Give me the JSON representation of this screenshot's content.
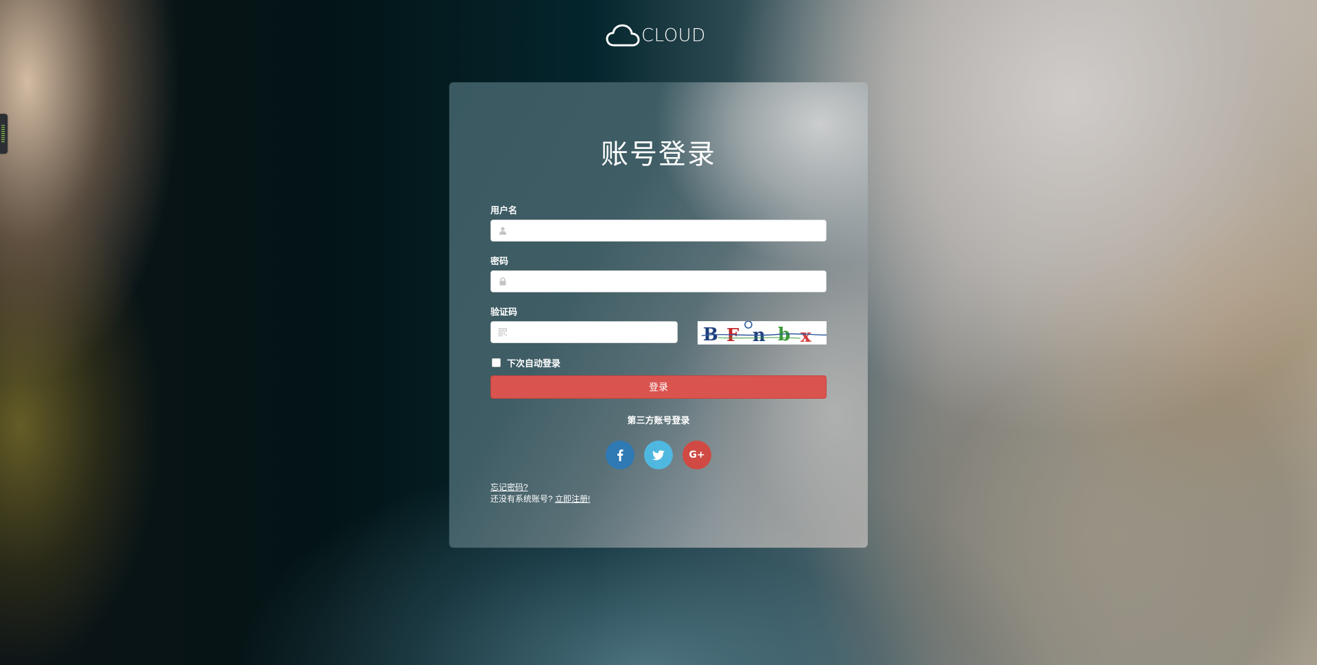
{
  "brand": {
    "logo_text": "CLOUD",
    "logo_icon": "cloud-icon"
  },
  "login": {
    "title": "账号登录",
    "username": {
      "label": "用户名",
      "value": "",
      "placeholder": "",
      "icon": "user-icon"
    },
    "password": {
      "label": "密码",
      "value": "",
      "placeholder": "",
      "icon": "lock-icon"
    },
    "captcha": {
      "label": "验证码",
      "value": "",
      "placeholder": "",
      "icon": "qrcode-icon",
      "image_text": "BFnbx"
    },
    "remember": {
      "label": "下次自动登录",
      "checked": false
    },
    "submit_label": "登录"
  },
  "third_party": {
    "title": "第三方账号登录",
    "providers": [
      {
        "name": "facebook",
        "icon": "facebook-icon",
        "color": "#2f79b4"
      },
      {
        "name": "twitter",
        "icon": "twitter-icon",
        "color": "#4fb8e0"
      },
      {
        "name": "google-plus",
        "icon": "google-plus-icon",
        "color": "#d04a43",
        "glyph": "G+"
      }
    ]
  },
  "links": {
    "forgot_password": "忘记密码?",
    "no_account_text": "还没有系统账号?",
    "register": "立即注册!"
  },
  "colors": {
    "primary_button": "#d9534f",
    "facebook": "#2f79b4",
    "twitter": "#4fb8e0",
    "google_plus": "#d04a43"
  }
}
